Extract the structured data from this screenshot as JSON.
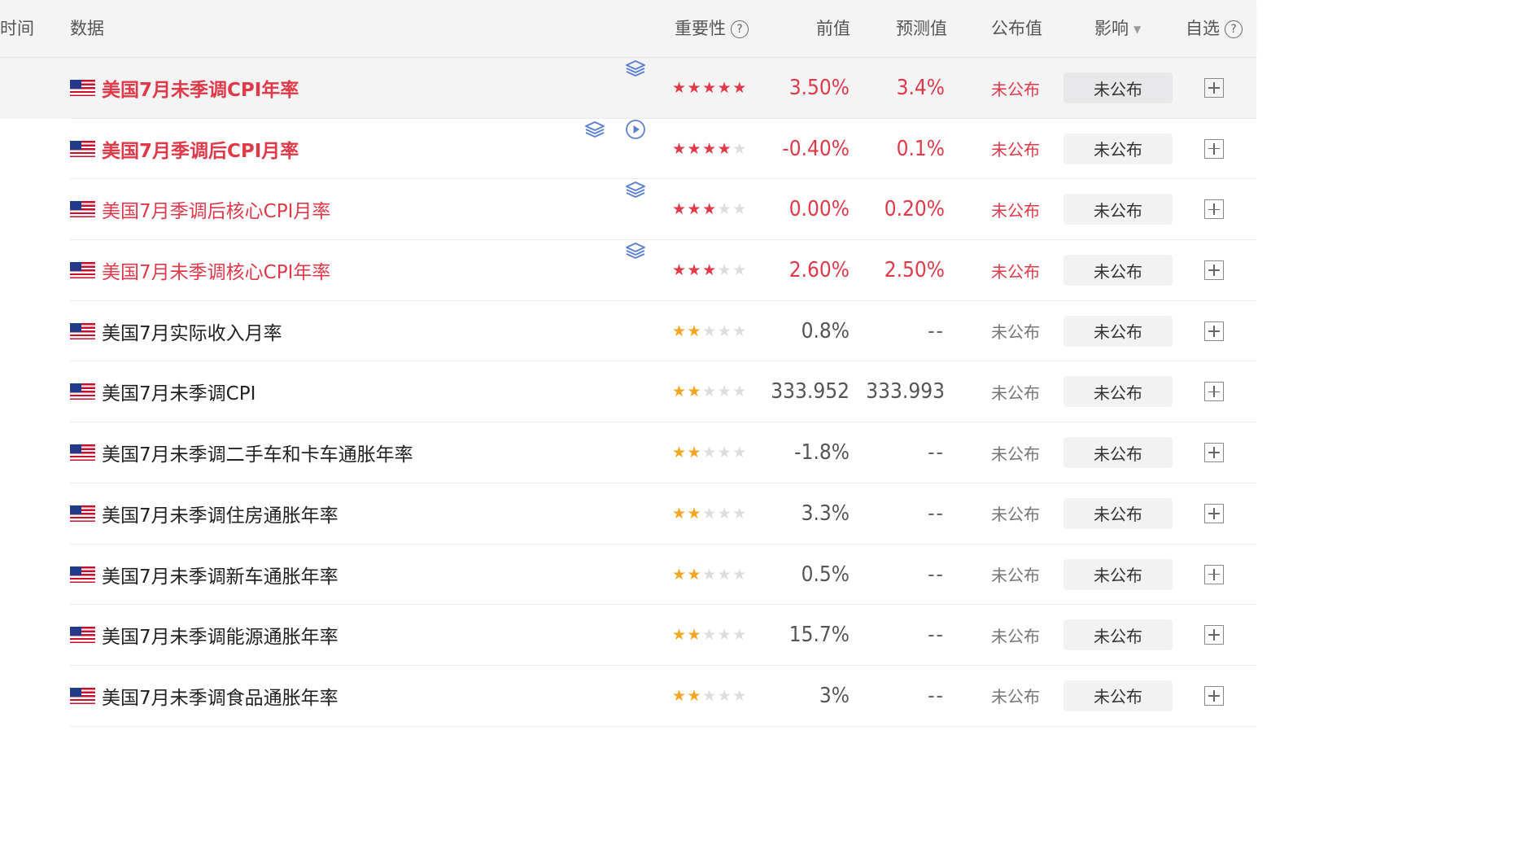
{
  "header": {
    "time": "时间",
    "data": "数据",
    "importance": "重要性",
    "previous": "前值",
    "forecast": "预测值",
    "published": "公布值",
    "impact": "影响",
    "watchlist": "自选",
    "help_glyph": "?",
    "caret_glyph": "▼"
  },
  "colors": {
    "accent_red": "#e03a4a",
    "star_gold": "#f2a623",
    "icon_blue": "#5b7fd1"
  },
  "rows": [
    {
      "name": "美国7月未季调CPI年率",
      "importance": 5,
      "star_color": "red",
      "previous": "3.50%",
      "forecast": "3.4%",
      "published": "未公布",
      "impact": "未公布",
      "icons": [
        "layers-icon"
      ]
    },
    {
      "name": "美国7月季调后CPI月率",
      "importance": 4,
      "star_color": "red",
      "previous": "-0.40%",
      "forecast": "0.1%",
      "published": "未公布",
      "impact": "未公布",
      "icons": [
        "layers-icon",
        "play-icon"
      ]
    },
    {
      "name": "美国7月季调后核心CPI月率",
      "importance": 3,
      "star_color": "red",
      "previous": "0.00%",
      "forecast": "0.20%",
      "published": "未公布",
      "impact": "未公布",
      "icons": [
        "layers-icon"
      ]
    },
    {
      "name": "美国7月未季调核心CPI年率",
      "importance": 3,
      "star_color": "red",
      "previous": "2.60%",
      "forecast": "2.50%",
      "published": "未公布",
      "impact": "未公布",
      "icons": [
        "layers-icon"
      ]
    },
    {
      "name": "美国7月实际收入月率",
      "importance": 2,
      "star_color": "gold",
      "previous": "0.8%",
      "forecast": "--",
      "published": "未公布",
      "impact": "未公布",
      "icons": []
    },
    {
      "name": "美国7月未季调CPI",
      "importance": 2,
      "star_color": "gold",
      "previous": "333.952",
      "forecast": "333.993",
      "published": "未公布",
      "impact": "未公布",
      "icons": []
    },
    {
      "name": "美国7月未季调二手车和卡车通胀年率",
      "importance": 2,
      "star_color": "gold",
      "previous": "-1.8%",
      "forecast": "--",
      "published": "未公布",
      "impact": "未公布",
      "icons": []
    },
    {
      "name": "美国7月未季调住房通胀年率",
      "importance": 2,
      "star_color": "gold",
      "previous": "3.3%",
      "forecast": "--",
      "published": "未公布",
      "impact": "未公布",
      "icons": []
    },
    {
      "name": "美国7月未季调新车通胀年率",
      "importance": 2,
      "star_color": "gold",
      "previous": "0.5%",
      "forecast": "--",
      "published": "未公布",
      "impact": "未公布",
      "icons": []
    },
    {
      "name": "美国7月未季调能源通胀年率",
      "importance": 2,
      "star_color": "gold",
      "previous": "15.7%",
      "forecast": "--",
      "published": "未公布",
      "impact": "未公布",
      "icons": []
    },
    {
      "name": "美国7月未季调食品通胀年率",
      "importance": 2,
      "star_color": "gold",
      "previous": "3%",
      "forecast": "--",
      "published": "未公布",
      "impact": "未公布",
      "icons": []
    }
  ]
}
